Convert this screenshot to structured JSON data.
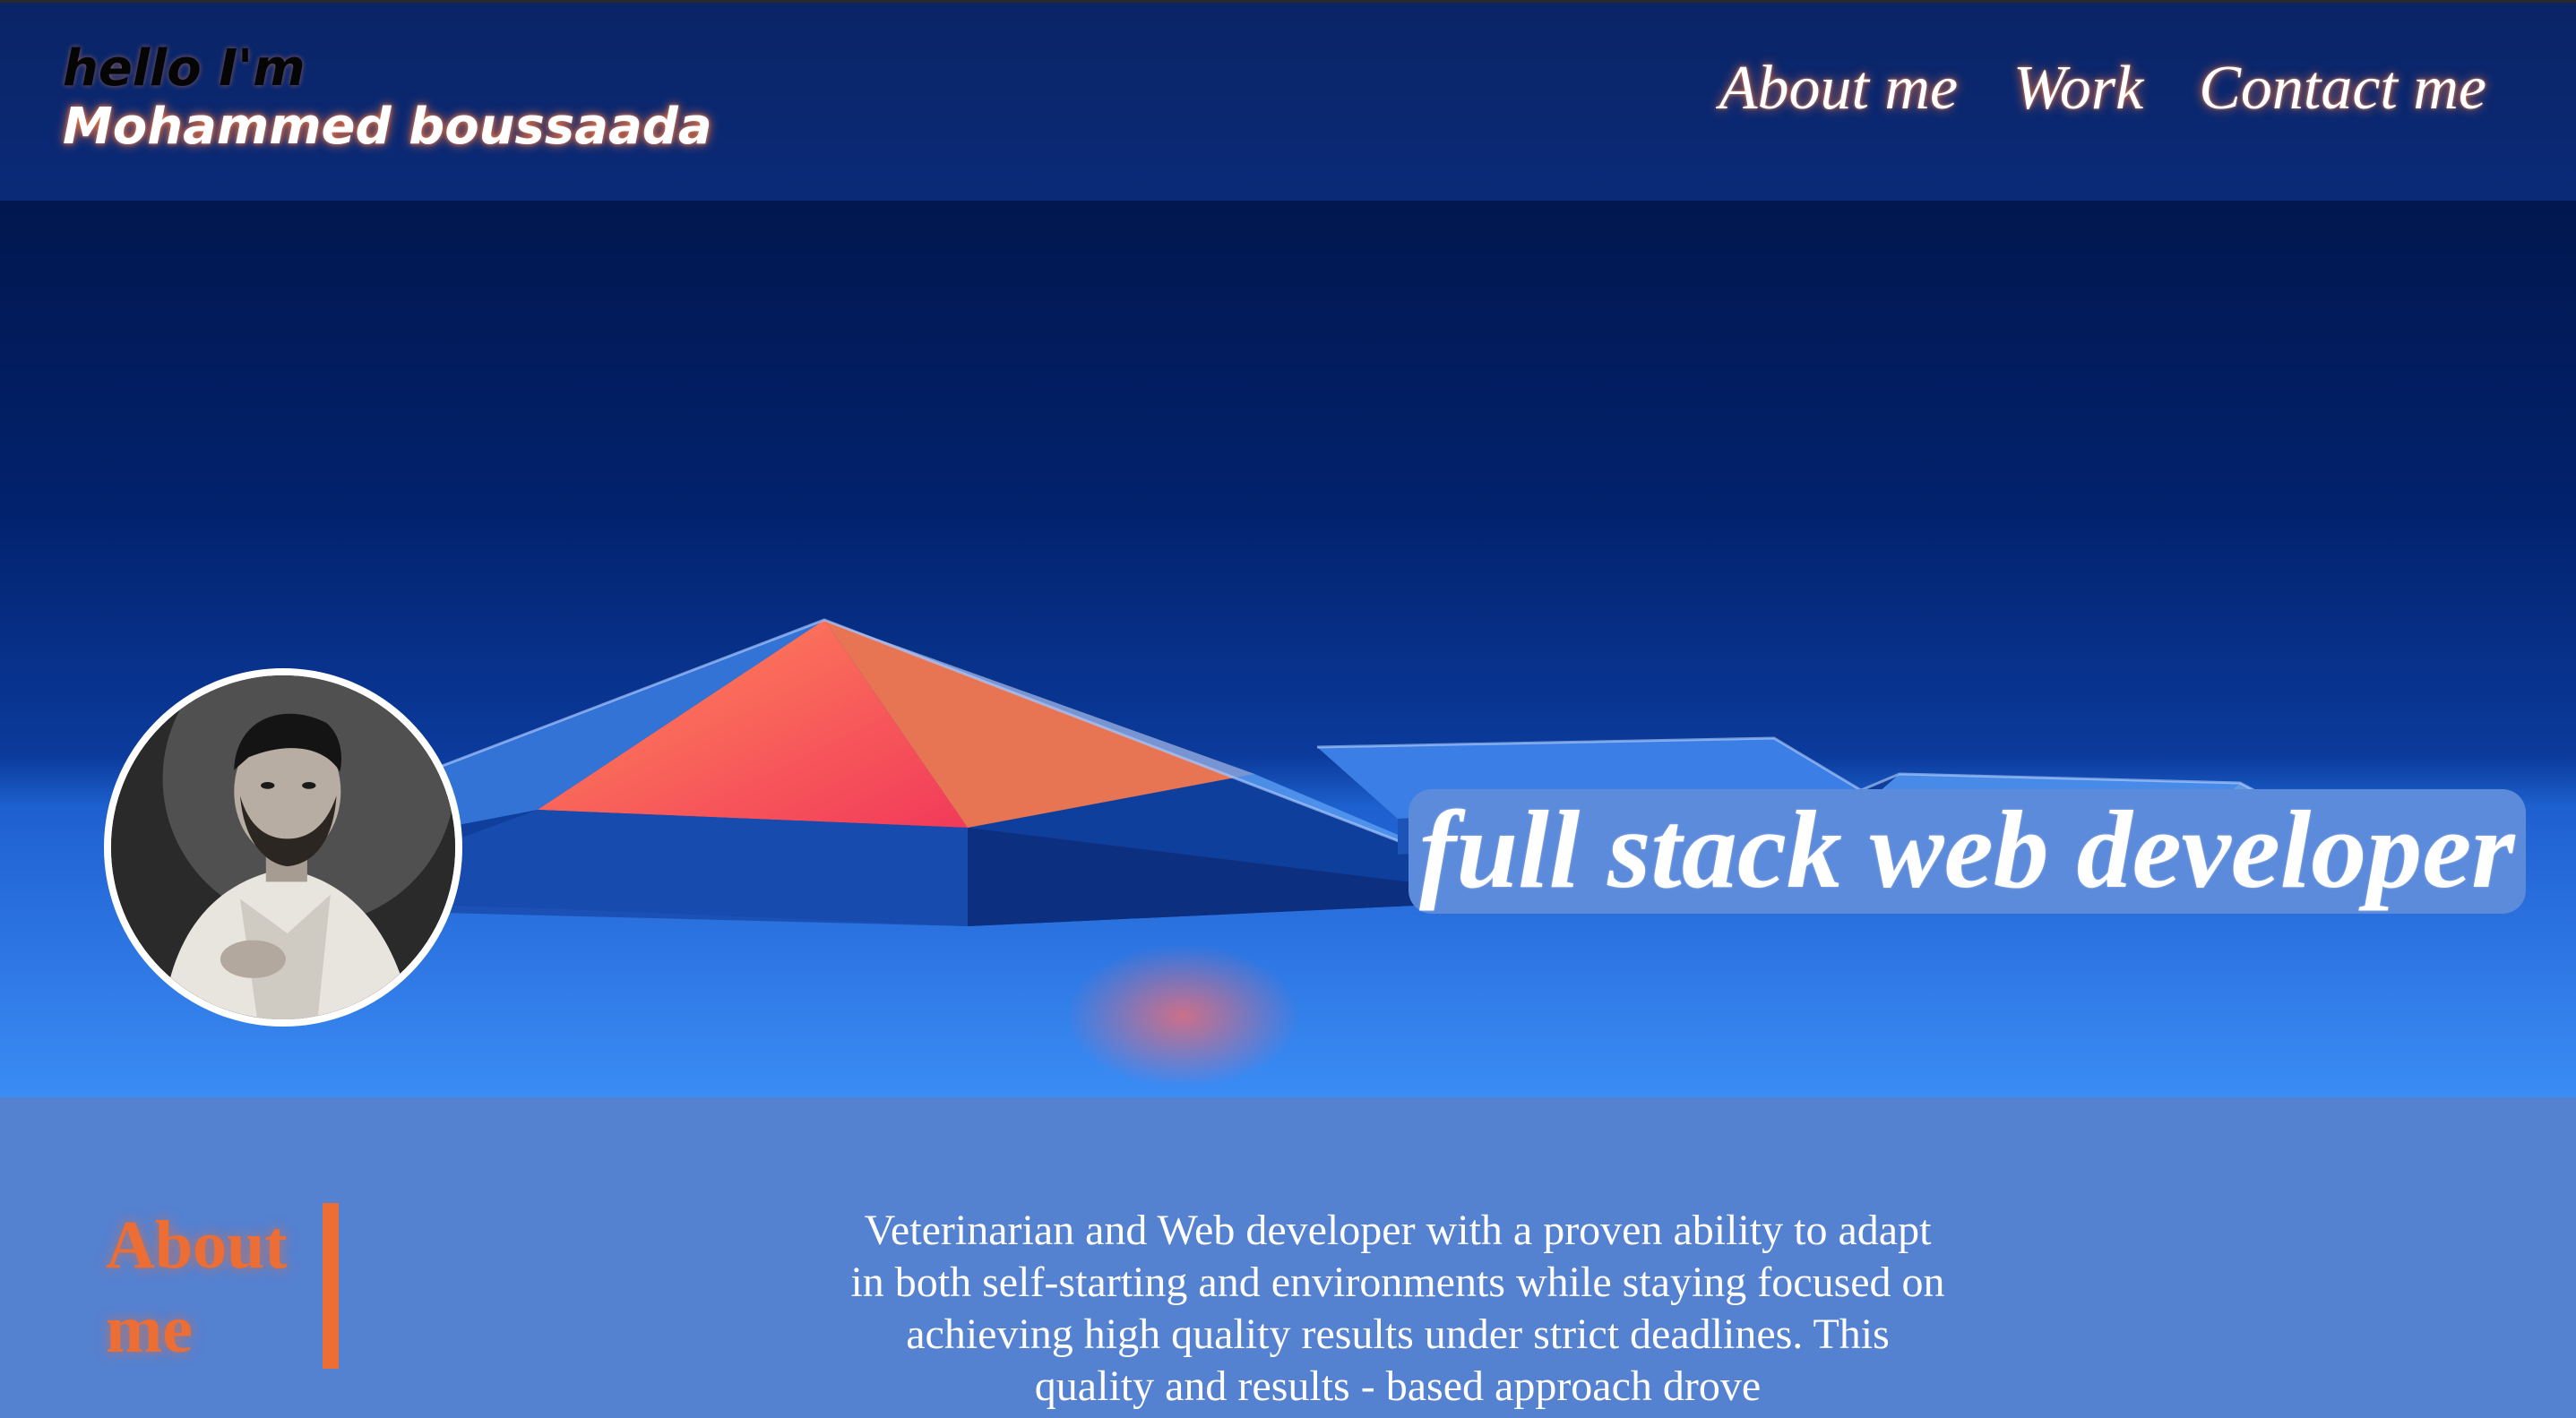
{
  "header": {
    "greeting": "hello I'm",
    "name": "Mohammed boussaada",
    "nav": [
      {
        "label": "About me"
      },
      {
        "label": "Work"
      },
      {
        "label": "Contact me"
      }
    ]
  },
  "hero": {
    "headline": "full stack web developer"
  },
  "about": {
    "title": "About me",
    "text": "Veterinarian and Web developer with a proven ability to adapt in both self-starting and environments while staying focused on achieving high quality results under strict deadlines. This quality and results - based approach drove"
  },
  "colors": {
    "header_bg": "#0a2466",
    "headline_bg": "#5d8bdb",
    "about_bg": "#5581d1",
    "accent": "#ec6e34"
  }
}
